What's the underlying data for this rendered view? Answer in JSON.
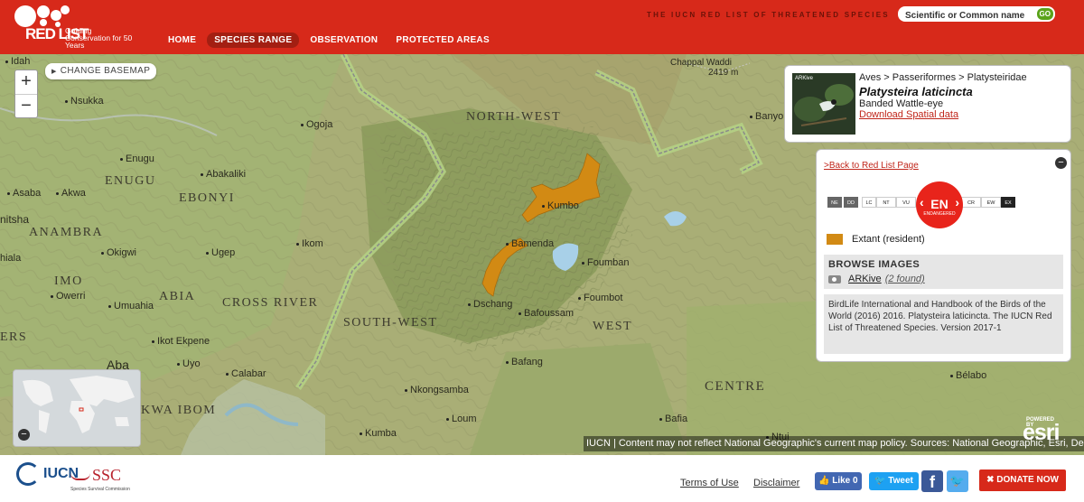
{
  "header": {
    "logo_redlist": "RED LIST",
    "logo_tagline": "Guiding Conservation for 50 Years",
    "nav": [
      "HOME",
      "SPECIES RANGE",
      "OBSERVATION",
      "PROTECTED AREAS"
    ],
    "active_nav": "SPECIES RANGE",
    "site_title": "THE IUCN RED LIST OF THREATENED SPECIES",
    "search_placeholder": "Scientific or Common name",
    "search_go": "GO",
    "brand_color": "#d7291a"
  },
  "map": {
    "basemap_button": "CHANGE BASEMAP",
    "zoom_in": "+",
    "zoom_out": "−",
    "overview_collapse": "−",
    "attribution": "IUCN | Content may not reflect National Geographic's current map policy. Sources: National Geographic, Esri, DeLorme, HERE, UNEP-WCMC, USGS, NASA, ESA, METI, NRCAN, GEBCO, NOAA, increment P Corp.",
    "esri_powered": "POWERED BY",
    "esri": "esri",
    "range_color": "#d28a14",
    "cities": {
      "idah": "Idah",
      "chappal": "Chappal Waddi",
      "chappal_elev": "2419 m",
      "nsukka": "Nsukka",
      "ogoja": "Ogoja",
      "banyo": "Banyo",
      "enugu": "Enugu",
      "abakaliki": "Abakaliki",
      "asaba": "Asaba",
      "akwa": "Akwa",
      "onitsha": "nitsha",
      "kumbo": "Kumbo",
      "ikom": "Ikom",
      "bamenda": "Bamenda",
      "ugep": "Ugep",
      "okigwi": "Okigwi",
      "nhaila": "hiala",
      "foumban": "Foumban",
      "owerri": "Owerri",
      "foumbot": "Foumbot",
      "umuahia": "Umuahia",
      "dschang": "Dschang",
      "bafoussam": "Bafoussam",
      "ikot": "Ikot Ekpene",
      "aba": "Aba",
      "uyo": "Uyo",
      "calabar": "Calabar",
      "bafang": "Bafang",
      "belabo": "Bélabo",
      "nkongsamba": "Nkongsamba",
      "bafia": "Bafia",
      "loum": "Loum",
      "kumba": "Kumba",
      "ntui": "Ntui"
    },
    "regions": {
      "north_west": "NORTH-WEST",
      "enugu": "ENUGU",
      "ebonyi": "EBONYI",
      "anambra": "ANAMBRA",
      "imo": "IMO",
      "abia": "ABIA",
      "cross_river": "CROSS RIVER",
      "south_west": "SOUTH-WEST",
      "west": "WEST",
      "rivers": "ERS",
      "akwa_ibom": "KWA IBOM",
      "centre": "CENTRE"
    }
  },
  "species": {
    "taxonomy": "Aves > Passeriformes > Platysteiridae",
    "scientific_name": "Platysteira laticincta",
    "common_name": "Banded Wattle-eye",
    "download": "Download Spatial data",
    "thumb_label": "ARKive"
  },
  "panel": {
    "back": ">Back to Red List Page",
    "collapse": "−",
    "categories": [
      "NE",
      "DD",
      "LC",
      "NT",
      "VU",
      "CR",
      "EW",
      "EX"
    ],
    "status_code": "EN",
    "status_name": "ENDANGERED",
    "legend_label": "Extant (resident)",
    "browse_title": "BROWSE IMAGES",
    "browse_source": "ARKive",
    "browse_count": "(2 found)",
    "citation": "BirdLife International and Handbook of the Birds of the World (2016) 2016. Platysteira laticincta. The IUCN Red List of Threatened Species. Version 2017-1"
  },
  "footer": {
    "iucn": "IUCN",
    "ssc": "SSC",
    "ssc_sub": "Species Survival Commission",
    "terms": "Terms of Use",
    "disclaimer": "Disclaimer",
    "like": "Like 0",
    "tweet": "Tweet",
    "donate": "DONATE NOW"
  }
}
